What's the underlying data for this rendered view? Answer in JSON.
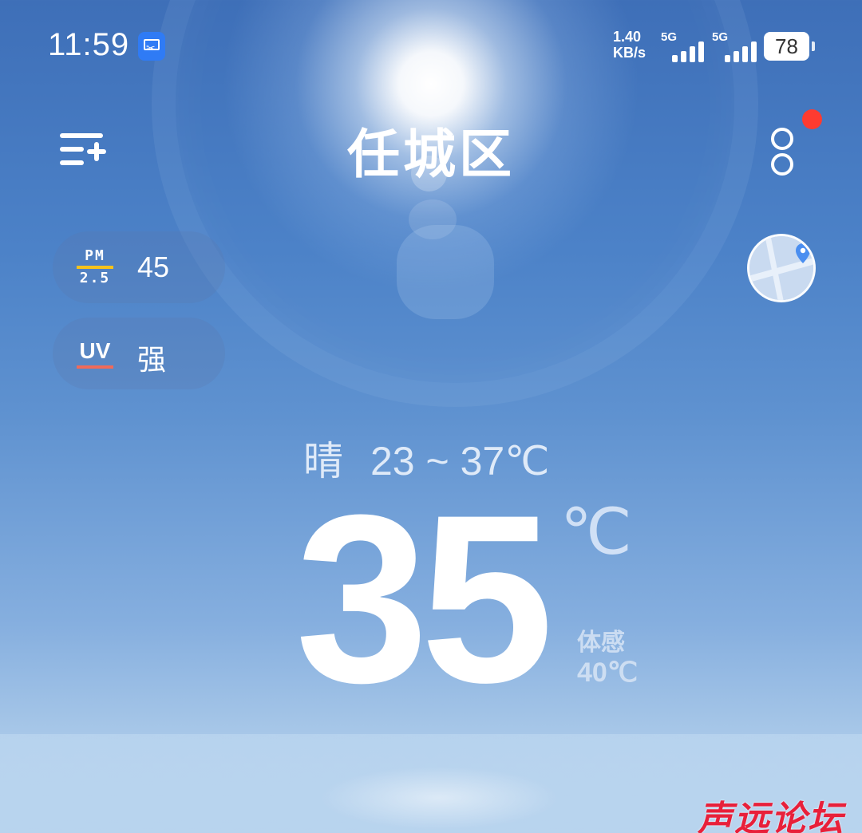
{
  "status_bar": {
    "time": "11:59",
    "net_speed_value": "1.40",
    "net_speed_unit": "KB/s",
    "sim1_label": "5G",
    "sim2_label": "5G",
    "battery": "78"
  },
  "header": {
    "city": "任城区"
  },
  "air": {
    "pm_label_top": "PM",
    "pm_label_bottom": "2.5",
    "pm_value": "45",
    "uv_label": "UV",
    "uv_value": "强"
  },
  "weather": {
    "condition": "晴",
    "range": "23 ~ 37℃",
    "temperature": "35",
    "unit": "℃",
    "feels_label": "体感",
    "feels_value": "40℃"
  },
  "watermark": "声远论坛",
  "colors": {
    "pm_underline": "#f5c21b",
    "uv_underline": "#ef6a5a",
    "notification_dot": "#ff3b30",
    "sky_top": "#3e6fb8",
    "sky_bottom": "#b6d2ee"
  },
  "icons": {
    "menu": "add-city-menu-icon",
    "more": "more-options-icon",
    "map": "map-location-icon",
    "screen": "screen-capture-icon"
  }
}
